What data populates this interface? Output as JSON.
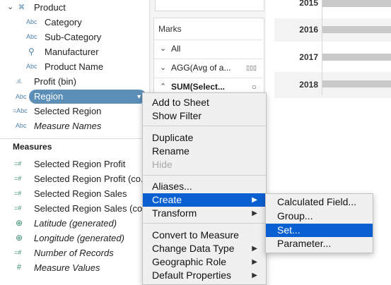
{
  "data_pane": {
    "dimensions": [
      {
        "icon": "hierarchy-icon",
        "glyph": "⌘",
        "label": "Product",
        "italic": false
      },
      {
        "icon": "abc-icon",
        "glyph": "Abc",
        "label": "Category",
        "italic": false
      },
      {
        "icon": "abc-icon",
        "glyph": "Abc",
        "label": "Sub-Category",
        "italic": false
      },
      {
        "icon": "paperclip-icon",
        "glyph": "⚲",
        "label": "Manufacturer",
        "italic": false
      },
      {
        "icon": "abc-icon",
        "glyph": "Abc",
        "label": "Product Name",
        "italic": false
      },
      {
        "icon": "bin-icon",
        "glyph": ".ıl.",
        "label": "Profit (bin)",
        "italic": false
      },
      {
        "icon": "abc-icon",
        "glyph": "Abc",
        "label": "Region",
        "italic": false
      },
      {
        "icon": "set-abc-icon",
        "glyph": "=Abc",
        "label": "Selected Region",
        "italic": false
      },
      {
        "icon": "abc-icon",
        "glyph": "Abc",
        "label": "Measure Names",
        "italic": true
      }
    ],
    "measures_title": "Measures",
    "measures": [
      {
        "icon": "measure-calc-icon",
        "glyph": "=#",
        "label": "Selected Region Profit",
        "italic": false
      },
      {
        "icon": "measure-calc-icon",
        "glyph": "=#",
        "label": "Selected Region Profit (co...",
        "italic": false
      },
      {
        "icon": "measure-calc-icon",
        "glyph": "=#",
        "label": "Selected Region Sales",
        "italic": false
      },
      {
        "icon": "measure-calc-icon",
        "glyph": "=#",
        "label": "Selected Region Sales (co...",
        "italic": false
      },
      {
        "icon": "globe-icon",
        "glyph": "⊕",
        "label": "Latitude (generated)",
        "italic": true
      },
      {
        "icon": "globe-icon",
        "glyph": "⊕",
        "label": "Longitude (generated)",
        "italic": true
      },
      {
        "icon": "measure-calc-icon",
        "glyph": "=#",
        "label": "Number of Records",
        "italic": true
      },
      {
        "icon": "measure-icon",
        "glyph": "#",
        "label": "Measure Values",
        "italic": true
      }
    ]
  },
  "marks": {
    "title": "Marks",
    "rows": [
      {
        "label": "All",
        "bold": false,
        "icon": ""
      },
      {
        "label": "AGG(Avg of a...",
        "bold": false,
        "icon": "▯▯▯"
      },
      {
        "label": "SUM(Select...",
        "bold": true,
        "icon": "○"
      }
    ]
  },
  "view": {
    "years": [
      "2015",
      "2016",
      "2017",
      "2018"
    ]
  },
  "context_menu": {
    "items": [
      {
        "label": "Add to Sheet",
        "submenu": false,
        "disabled": false,
        "highlighted": false
      },
      {
        "label": "Show Filter",
        "submenu": false,
        "disabled": false,
        "highlighted": false
      },
      {
        "label": "Duplicate",
        "submenu": false,
        "disabled": false,
        "highlighted": false
      },
      {
        "label": "Rename",
        "submenu": false,
        "disabled": false,
        "highlighted": false
      },
      {
        "label": "Hide",
        "submenu": false,
        "disabled": true,
        "highlighted": false
      },
      {
        "label": "Aliases...",
        "submenu": false,
        "disabled": false,
        "highlighted": false
      },
      {
        "label": "Create",
        "submenu": true,
        "disabled": false,
        "highlighted": true
      },
      {
        "label": "Transform",
        "submenu": true,
        "disabled": false,
        "highlighted": false
      },
      {
        "label": "Convert to Measure",
        "submenu": false,
        "disabled": false,
        "highlighted": false
      },
      {
        "label": "Change Data Type",
        "submenu": true,
        "disabled": false,
        "highlighted": false
      },
      {
        "label": "Geographic Role",
        "submenu": true,
        "disabled": false,
        "highlighted": false
      },
      {
        "label": "Default Properties",
        "submenu": true,
        "disabled": false,
        "highlighted": false
      }
    ]
  },
  "sub_menu": {
    "items": [
      {
        "label": "Calculated Field...",
        "highlighted": false
      },
      {
        "label": "Group...",
        "highlighted": false
      },
      {
        "label": "Set...",
        "highlighted": true
      },
      {
        "label": "Parameter...",
        "highlighted": false
      }
    ]
  },
  "colors": {
    "pill": "#5b8fb8",
    "menu_highlight": "#0a5fd1",
    "menu_bg": "#f0f0f0"
  }
}
